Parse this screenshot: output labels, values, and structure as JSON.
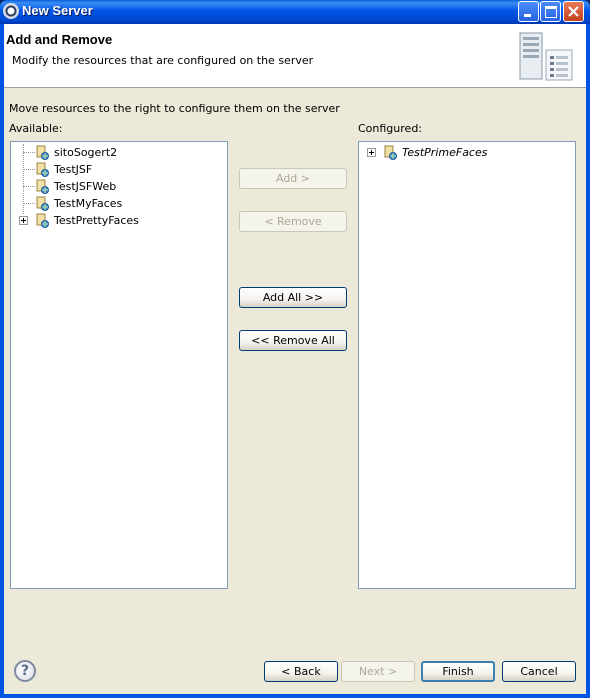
{
  "window": {
    "title": "New Server",
    "controls": [
      "minimize",
      "maximize",
      "close"
    ]
  },
  "header": {
    "title": "Add and Remove",
    "description": "Modify the resources that are configured on the server"
  },
  "instruction": "Move resources to the right to configure them on the server",
  "available": {
    "label": "Available:",
    "items": [
      {
        "label": "sitoSogert2",
        "expandable": false
      },
      {
        "label": "TestJSF",
        "expandable": false
      },
      {
        "label": "TestJSFWeb",
        "expandable": false
      },
      {
        "label": "TestMyFaces",
        "expandable": false
      },
      {
        "label": "TestPrettyFaces",
        "expandable": true
      }
    ]
  },
  "configured": {
    "label": "Configured:",
    "items": [
      {
        "label": "TestPrimeFaces",
        "expandable": true
      }
    ]
  },
  "actions": {
    "add": "Add >",
    "remove": "< Remove",
    "add_all": "Add All >>",
    "remove_all": "<< Remove All"
  },
  "footer": {
    "back": "< Back",
    "next": "Next >",
    "finish": "Finish",
    "cancel": "Cancel",
    "help": "?"
  }
}
